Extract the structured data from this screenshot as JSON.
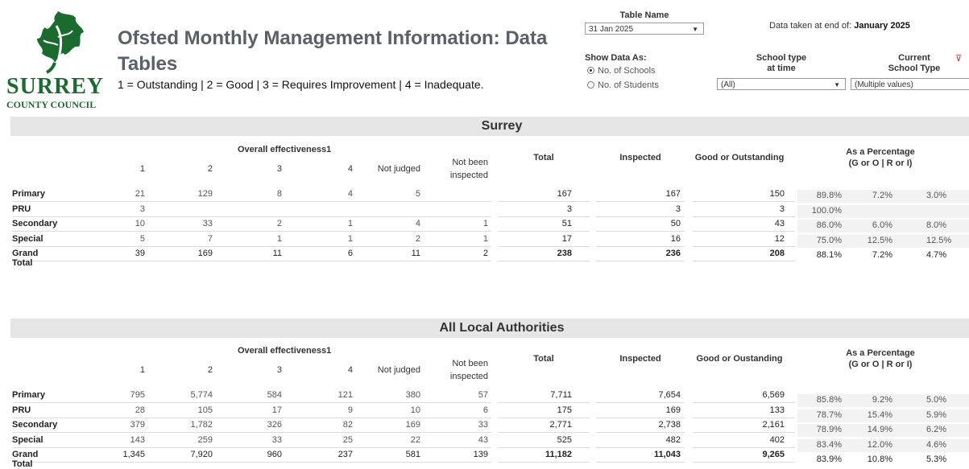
{
  "logo": {
    "word": "SURREY",
    "sub": "COUNTY COUNCIL"
  },
  "title": "Ofsted Monthly Management Information: Data Tables",
  "legend": "1 = Outstanding | 2 = Good | 3 = Requires Improvement | 4 = Inadequate.",
  "table_name": {
    "label": "Table Name",
    "value": "31 Jan 2025"
  },
  "data_taken": {
    "label": "Data taken at end of:",
    "value": "January 2025"
  },
  "show_data_as": {
    "label": "Show Data As:",
    "options": [
      "No. of Schools",
      "No. of Students"
    ],
    "selected": 0
  },
  "school_type_time": {
    "label_line1": "School type",
    "label_line2": "at time",
    "value": "(All)"
  },
  "current_school_type": {
    "label_line1": "Current",
    "label_line2": "School Type",
    "value": "(Multiple values)"
  },
  "headers": {
    "overall": "Overall effectiveness1",
    "cols": [
      "1",
      "2",
      "3",
      "4",
      "Not judged"
    ],
    "not_been_1": "Not been",
    "not_been_2": "inspected",
    "total": "Total",
    "inspected": "Inspected",
    "good": "Good or Outstanding",
    "good_all": "Good or Oustanding",
    "pct_1": "As a Percentage",
    "pct_2": "(G or O | R or I)"
  },
  "surrey": {
    "title": "Surrey",
    "rows": [
      {
        "label": "Primary",
        "v1": "21",
        "v2": "129",
        "v3": "8",
        "v4": "4",
        "nj": "5",
        "nbi": "",
        "total": "167",
        "insp": "167",
        "good": "150",
        "p1": "89.8%",
        "p2": "7.2%",
        "p3": "3.0%"
      },
      {
        "label": "PRU",
        "v1": "3",
        "v2": "",
        "v3": "",
        "v4": "",
        "nj": "",
        "nbi": "",
        "total": "3",
        "insp": "3",
        "good": "3",
        "p1": "100.0%",
        "p2": "",
        "p3": ""
      },
      {
        "label": "Secondary",
        "v1": "10",
        "v2": "33",
        "v3": "2",
        "v4": "1",
        "nj": "4",
        "nbi": "1",
        "total": "51",
        "insp": "50",
        "good": "43",
        "p1": "86.0%",
        "p2": "6.0%",
        "p3": "8.0%"
      },
      {
        "label": "Special",
        "v1": "5",
        "v2": "7",
        "v3": "1",
        "v4": "1",
        "nj": "2",
        "nbi": "1",
        "total": "17",
        "insp": "16",
        "good": "12",
        "p1": "75.0%",
        "p2": "12.5%",
        "p3": "12.5%"
      },
      {
        "label": "Grand Total",
        "v1": "39",
        "v2": "169",
        "v3": "11",
        "v4": "6",
        "nj": "11",
        "nbi": "2",
        "total": "238",
        "insp": "236",
        "good": "208",
        "p1": "88.1%",
        "p2": "7.2%",
        "p3": "4.7%"
      }
    ]
  },
  "all": {
    "title": "All Local Authorities",
    "rows": [
      {
        "label": "Primary",
        "v1": "795",
        "v2": "5,774",
        "v3": "584",
        "v4": "121",
        "nj": "380",
        "nbi": "57",
        "total": "7,711",
        "insp": "7,654",
        "good": "6,569",
        "p1": "85.8%",
        "p2": "9.2%",
        "p3": "5.0%"
      },
      {
        "label": "PRU",
        "v1": "28",
        "v2": "105",
        "v3": "17",
        "v4": "9",
        "nj": "10",
        "nbi": "6",
        "total": "175",
        "insp": "169",
        "good": "133",
        "p1": "78.7%",
        "p2": "15.4%",
        "p3": "5.9%"
      },
      {
        "label": "Secondary",
        "v1": "379",
        "v2": "1,782",
        "v3": "326",
        "v4": "82",
        "nj": "169",
        "nbi": "33",
        "total": "2,771",
        "insp": "2,738",
        "good": "2,161",
        "p1": "78.9%",
        "p2": "14.9%",
        "p3": "6.2%"
      },
      {
        "label": "Special",
        "v1": "143",
        "v2": "259",
        "v3": "33",
        "v4": "25",
        "nj": "22",
        "nbi": "43",
        "total": "525",
        "insp": "482",
        "good": "402",
        "p1": "83.4%",
        "p2": "12.0%",
        "p3": "4.6%"
      },
      {
        "label": "Grand Total",
        "v1": "1,345",
        "v2": "7,920",
        "v3": "960",
        "v4": "237",
        "nj": "581",
        "nbi": "139",
        "total": "11,182",
        "insp": "11,043",
        "good": "9,265",
        "p1": "83.9%",
        "p2": "10.8%",
        "p3": "5.3%"
      }
    ]
  }
}
